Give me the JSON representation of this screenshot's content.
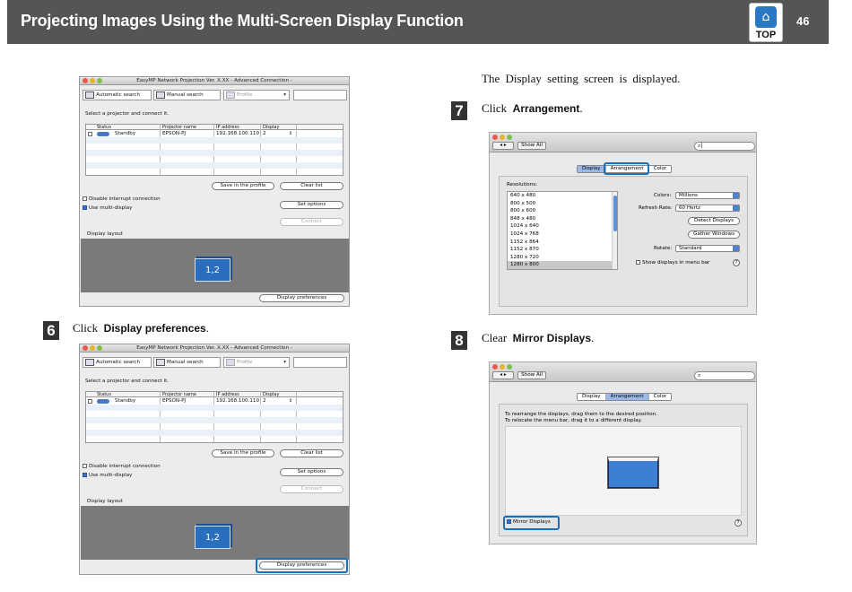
{
  "header": {
    "title": "Projecting Images Using the Multi-Screen Display Function",
    "top_label": "TOP",
    "page_number": "46"
  },
  "easymp": {
    "window_title": "EasyMP Network Projection Ver. X.XX - Advanced Connection -",
    "automatic_search": "Automatic search",
    "manual_search": "Manual search",
    "profile": "Profile",
    "select_prompt": "Select a projector and connect it.",
    "columns": [
      "Status",
      "Projector name",
      "IP address",
      "Display"
    ],
    "row": {
      "status": "Standby",
      "name": "EPSON-PJ",
      "ip": "192.168.100.110",
      "display": "2"
    },
    "save_profile": "Save in the profile",
    "clear_list": "Clear list",
    "disable_interrupt": "Disable interrupt connection",
    "use_multi_display": "Use multi-display",
    "set_options": "Set options",
    "connect": "Connect",
    "display_layout": "Display layout",
    "display_icon": "1,2",
    "display_preferences": "Display preferences"
  },
  "steps": {
    "intro": "The Display setting screen is displayed.",
    "s6": {
      "num": "6",
      "pre": "Click",
      "bold": "Display preferences",
      "post": "."
    },
    "s7": {
      "num": "7",
      "pre": "Click",
      "bold": "Arrangement",
      "post": "."
    },
    "s8": {
      "num": "8",
      "pre": "Clear",
      "bold": "Mirror Displays",
      "post": "."
    }
  },
  "prefs": {
    "show_all": "Show All",
    "tabs": [
      "Display",
      "Arrangement",
      "Color"
    ],
    "resolutions_label": "Resolutions:",
    "resolutions": [
      "640 x 480",
      "800 x 500",
      "800 x 600",
      "848 x 480",
      "1024 x 640",
      "1024 x 768",
      "1152 x 864",
      "1152 x 870",
      "1280 x 720",
      "1280 x 800"
    ],
    "colors_label": "Colors:",
    "colors_value": "Millions",
    "refresh_label": "Refresh Rate:",
    "refresh_value": "60 Hertz",
    "detect_displays": "Detect Displays",
    "gather_windows": "Gather Windows",
    "rotate_label": "Rotate:",
    "rotate_value": "Standard",
    "show_menu_bar": "Show displays in menu bar",
    "arrange_text1": "To rearrange the displays, drag them to the desired position.",
    "arrange_text2": "To relocate the menu bar, drag it to a different display.",
    "mirror_displays": "Mirror Displays",
    "help": "?"
  }
}
